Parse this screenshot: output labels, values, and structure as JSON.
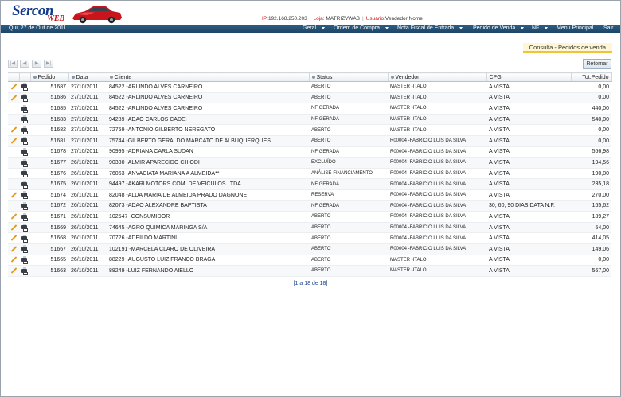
{
  "header": {
    "logo_text": "Sercon",
    "logo_sub": "WEB",
    "ip_label": "IP:",
    "ip_value": "192.168.250.203",
    "loja_label": "Loja:",
    "loja_value": "MATRIZVWAB",
    "usuario_label": "Usuário:",
    "usuario_value": "Vendedor Nome"
  },
  "nav": {
    "date": "Qui, 27 de Out de 2011",
    "items": [
      {
        "label": "Geral"
      },
      {
        "label": "Ordem de Compra"
      },
      {
        "label": "Nota Fiscal de Entrada"
      },
      {
        "label": "Pedido de Venda"
      },
      {
        "label": "NF"
      },
      {
        "label": "Menu Principal"
      },
      {
        "label": "Sair"
      }
    ]
  },
  "page": {
    "title": "Consulta - Pedidos de venda",
    "return_label": "Retornar",
    "pagination": "[1 a 18 de 18]"
  },
  "table": {
    "columns": [
      "Pedido",
      "Data",
      "Cliente",
      "Status",
      "Vendedor",
      "CPG",
      "Tot.Pedido"
    ],
    "rows": [
      {
        "edit": true,
        "pedido": "51687",
        "data": "27/10/2011",
        "cliente": "84522 -ARLINDO ALVES CARNEIRO",
        "status": "ABERTO",
        "vendedor": "MASTER -ITALO",
        "cpg": "A VISTA",
        "total": "0,00"
      },
      {
        "edit": true,
        "pedido": "51686",
        "data": "27/10/2011",
        "cliente": "84522 -ARLINDO ALVES CARNEIRO",
        "status": "ABERTO",
        "vendedor": "MASTER -ITALO",
        "cpg": "A VISTA",
        "total": "0,00"
      },
      {
        "edit": false,
        "pedido": "51685",
        "data": "27/10/2011",
        "cliente": "84522 -ARLINDO ALVES CARNEIRO",
        "status": "NF GERADA",
        "vendedor": "MASTER -ITALO",
        "cpg": "A VISTA",
        "total": "440,00"
      },
      {
        "edit": false,
        "pedido": "51683",
        "data": "27/10/2011",
        "cliente": "94289 -ADAO CARLOS CADEI",
        "status": "NF GERADA",
        "vendedor": "MASTER -ITALO",
        "cpg": "A VISTA",
        "total": "540,00"
      },
      {
        "edit": true,
        "pedido": "51682",
        "data": "27/10/2011",
        "cliente": "72759 -ANTONIO GILBERTO NEREGATO",
        "status": "ABERTO",
        "vendedor": "MASTER -ITALO",
        "cpg": "A VISTA",
        "total": "0,00"
      },
      {
        "edit": true,
        "pedido": "51681",
        "data": "27/10/2011",
        "cliente": "75744 -GILBERTO GERALDO MARCATO DE ALBUQUERQUES",
        "status": "ABERTO",
        "vendedor": "R00004 -FABRICIO LUIS DA SILVA",
        "cpg": "A VISTA",
        "total": "0,00"
      },
      {
        "edit": false,
        "pedido": "51678",
        "data": "27/10/2011",
        "cliente": "90995 -ADRIANA CARLA SUDAN",
        "status": "NF GERADA",
        "vendedor": "R00004 -FABRICIO LUIS DA SILVA",
        "cpg": "A VISTA",
        "total": "566,98"
      },
      {
        "edit": false,
        "pedido": "51677",
        "data": "26/10/2011",
        "cliente": "90330 -ALMIR APARECIDO CHIODI",
        "status": "EXCLUÍDO",
        "vendedor": "R00004 -FABRICIO LUIS DA SILVA",
        "cpg": "A VISTA",
        "total": "194,56"
      },
      {
        "edit": false,
        "pedido": "51676",
        "data": "26/10/2011",
        "cliente": "76063 -ANVACIATA MARIANA A ALMEIDA**",
        "status": "ANÁLISE-FINANCIAMENTO",
        "vendedor": "R00004 -FABRICIO LUIS DA SILVA",
        "cpg": "A VISTA",
        "total": "190,00"
      },
      {
        "edit": false,
        "pedido": "51675",
        "data": "26/10/2011",
        "cliente": "94497 -AKARI MOTORS COM. DE VEICULOS LTDA",
        "status": "NF GERADA",
        "vendedor": "R00004 -FABRICIO LUIS DA SILVA",
        "cpg": "A VISTA",
        "total": "235,18"
      },
      {
        "edit": true,
        "pedido": "51674",
        "data": "26/10/2011",
        "cliente": "82048 -ALDA MARIA DE ALMEIDA PRADO DAGNONE",
        "status": "RESERVA",
        "vendedor": "R00004 -FABRICIO LUIS DA SILVA",
        "cpg": "A VISTA",
        "total": "270,00"
      },
      {
        "edit": false,
        "pedido": "51672",
        "data": "26/10/2011",
        "cliente": "82073 -ADAO ALEXANDRE BAPTISTA",
        "status": "NF GERADA",
        "vendedor": "R00004 -FABRICIO LUIS DA SILVA",
        "cpg": "30, 60, 90 DIAS DATA N.F.",
        "total": "165,62"
      },
      {
        "edit": true,
        "pedido": "51671",
        "data": "26/10/2011",
        "cliente": "102547 -CONSUMIDOR",
        "status": "ABERTO",
        "vendedor": "R00004 -FABRICIO LUIS DA SILVA",
        "cpg": "A VISTA",
        "total": "189,27"
      },
      {
        "edit": true,
        "pedido": "51669",
        "data": "26/10/2011",
        "cliente": "74645 -AGRO QUIMICA MARINGA S/A",
        "status": "ABERTO",
        "vendedor": "R00004 -FABRICIO LUIS DA SILVA",
        "cpg": "A VISTA",
        "total": "54,00"
      },
      {
        "edit": true,
        "pedido": "51668",
        "data": "26/10/2011",
        "cliente": "70726 -ADEILDO MARTINI",
        "status": "ABERTO",
        "vendedor": "R00004 -FABRICIO LUIS DA SILVA",
        "cpg": "A VISTA",
        "total": "414,05"
      },
      {
        "edit": true,
        "pedido": "51667",
        "data": "26/10/2011",
        "cliente": "102191 -MARCELA CLARO DE OLIVEIRA",
        "status": "ABERTO",
        "vendedor": "R00004 -FABRICIO LUIS DA SILVA",
        "cpg": "A VISTA",
        "total": "149,06"
      },
      {
        "edit": true,
        "pedido": "51665",
        "data": "26/10/2011",
        "cliente": "88229 -AUGUSTO LUIZ FRANCO BRAGA",
        "status": "ABERTO",
        "vendedor": "MASTER -ITALO",
        "cpg": "A VISTA",
        "total": "0,00"
      },
      {
        "edit": true,
        "pedido": "51663",
        "data": "26/10/2011",
        "cliente": "88249 -LUIZ FERNANDO AIELLO",
        "status": "ABERTO",
        "vendedor": "MASTER -ITALO",
        "cpg": "A VISTA",
        "total": "567,00"
      }
    ]
  },
  "icons": {
    "edit": "pencil-icon",
    "print": "printer-icon",
    "pager": [
      "first-page-icon",
      "prev-page-icon",
      "next-page-icon",
      "last-page-icon"
    ]
  },
  "colors": {
    "nav_bar": "#1d4566",
    "logo_blue": "#123a8a",
    "logo_red": "#c8101a",
    "title_highlight": "#f0c33a",
    "edit_icon": "#e69a1a"
  }
}
